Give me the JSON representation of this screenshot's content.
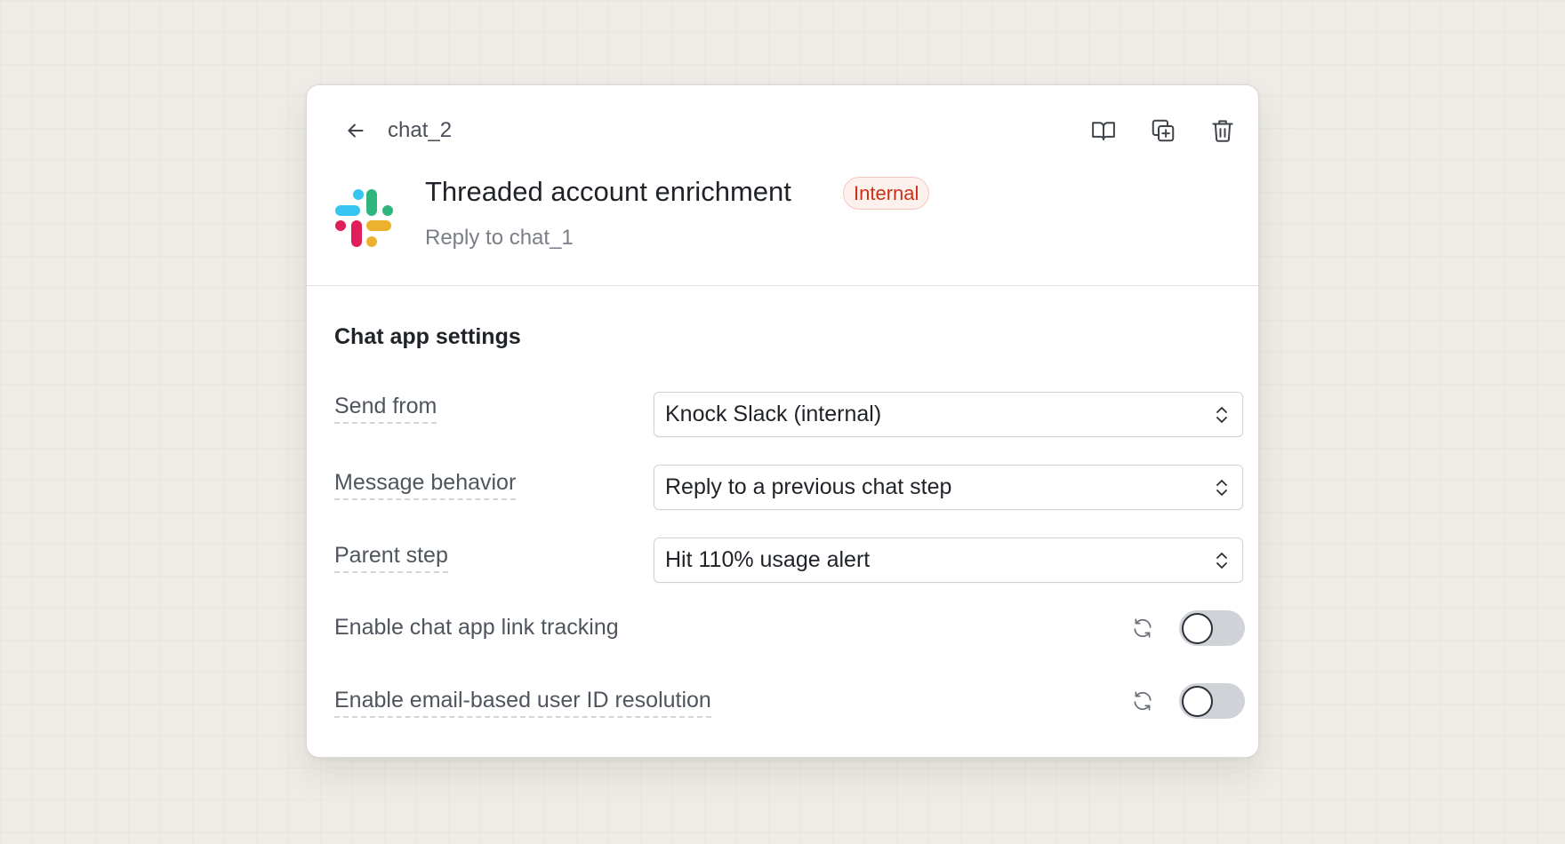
{
  "header": {
    "breadcrumb": "chat_2",
    "title": "Threaded account enrichment",
    "badge": "Internal",
    "subtitle": "Reply to chat_1",
    "logo": "slack-logo",
    "tools": [
      "book-open-icon",
      "duplicate-icon",
      "trash-icon"
    ]
  },
  "settings": {
    "section_title": "Chat app settings",
    "send_from": {
      "label": "Send from",
      "value": "Knock Slack (internal)"
    },
    "message_behavior": {
      "label": "Message behavior",
      "value": "Reply to a previous chat step"
    },
    "parent_step": {
      "label": "Parent step",
      "value": "Hit 110% usage alert"
    },
    "link_tracking": {
      "label": "Enable chat app link tracking",
      "enabled": false
    },
    "email_resolution": {
      "label": "Enable email-based user ID resolution",
      "enabled": false
    }
  },
  "colors": {
    "badge_text": "#cf2f14",
    "badge_bg": "#fdf1ee",
    "toggle_off": "#cfd2d6",
    "slack_blue": "#36c5f0",
    "slack_green": "#2eb67d",
    "slack_red": "#e01e5a",
    "slack_yellow": "#ecb22e"
  }
}
